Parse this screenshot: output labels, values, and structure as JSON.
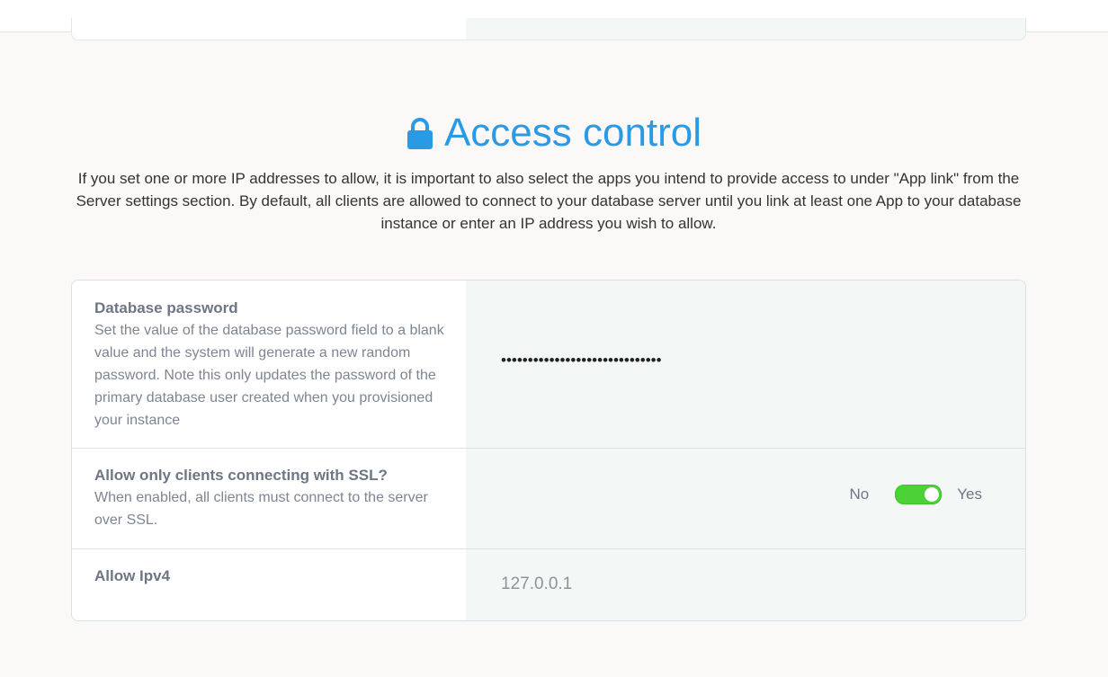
{
  "section": {
    "title": "Access control",
    "description": "If you set one or more IP addresses to allow, it is important to also select the apps you intend to provide access to under \"App link\" from the Server settings section. By default, all clients are allowed to connect to your database server until you link at least one App to your database instance or enter an IP address you wish to allow.",
    "title_color": "#2a9ae5",
    "icon": "lock-icon"
  },
  "settings": {
    "password": {
      "label": "Database password",
      "help": "Set the value of the database password field to a blank value and the system will generate a new random password. Note this only updates the password of the primary database user created when you provisioned your instance",
      "value": "••••••••••••••••••••••••••••••"
    },
    "ssl": {
      "label": "Allow only clients connecting with SSL?",
      "help": "When enabled, all clients must connect to the server over SSL.",
      "off_label": "No",
      "on_label": "Yes",
      "enabled": true,
      "toggle_color": "#4cd137"
    },
    "ipv4": {
      "label": "Allow Ipv4",
      "value": "127.0.0.1"
    }
  }
}
